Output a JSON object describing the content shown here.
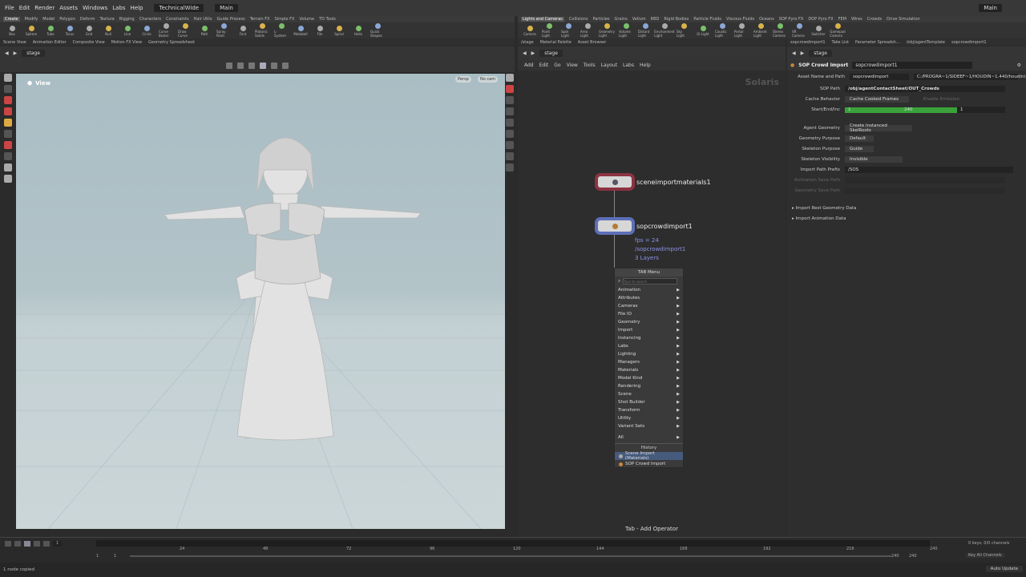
{
  "menubar": {
    "items": [
      "File",
      "Edit",
      "Render",
      "Assets",
      "Windows",
      "Labs",
      "Help"
    ],
    "desktop": "TechnicalWide",
    "context": "Main",
    "right_context": "Main"
  },
  "shelf_tabs_left": [
    "Create",
    "Modify",
    "Model",
    "Polygon",
    "Deform",
    "Texture",
    "Rigging",
    "Characters",
    "Constraints",
    "Hair Utils",
    "Guide Process",
    "Terrain FX",
    "Simple FX",
    "Volume",
    "TD Tools"
  ],
  "shelf_tools_left": [
    "Box",
    "Sphere",
    "Tube",
    "Torus",
    "Grid",
    "Null",
    "Line",
    "Circle",
    "Curve Bezier",
    "Draw Curve",
    "Path",
    "Spray Paint",
    "Font",
    "Platonic Solids",
    "L-System",
    "Metaball",
    "File",
    "Spiral",
    "Helix",
    "Quick Shapes"
  ],
  "shelf_tabs_right": [
    "Lights and Cameras",
    "Collisions",
    "Particles",
    "Grains",
    "Vellum",
    "RBD",
    "Rigid Bodies",
    "Particle Fluids",
    "Viscous Fluids",
    "Oceans",
    "SOP Pyro FX",
    "DOP Pyro FX",
    "FEM",
    "Wires",
    "Crowds",
    "Drive Simulation"
  ],
  "shelf_tools_right": [
    "Camera",
    "Point Light",
    "Spot Light",
    "Area Light",
    "Geometry Light",
    "Volume Light",
    "Distant Light",
    "Environment Light",
    "Sky Light",
    "GI Light",
    "Caustic Light",
    "Portal Light",
    "Ambient Light",
    "Stereo Camera",
    "VR Camera",
    "Switcher",
    "Gamepad Camera"
  ],
  "pane_tabs_left": [
    "Scene View",
    "Animation Editor",
    "Composite View",
    "Motion FX View",
    "Geometry Spreadsheet"
  ],
  "pane_tabs_mid": [
    "/stage",
    "Material Palette",
    "Asset Browser"
  ],
  "pane_tabs_right": [
    "sopcrowdimport1",
    "Take List",
    "Parameter Spreadsh...",
    "/obj/agentTemplate",
    "sopcrowdimport1"
  ],
  "viewport": {
    "path": "stage",
    "label": "View",
    "persp": "Persp",
    "cam": "No cam"
  },
  "network": {
    "path": "stage",
    "menu": [
      "Add",
      "Edit",
      "Go",
      "View",
      "Tools",
      "Layout",
      "Labs",
      "Help"
    ],
    "watermark": "Solaris",
    "status": "Tab - Add Operator",
    "node1": {
      "name": "sceneimportmaterials1"
    },
    "node2": {
      "name": "sopcrowdimport1",
      "fps": "fps = 24",
      "path": "/sopcrowdimport1",
      "layers": "3 Layers"
    }
  },
  "tabmenu": {
    "title": "TAB Menu",
    "placeholder": "Type to search",
    "items": [
      "Animation",
      "Attributes",
      "Cameras",
      "File IO",
      "Geometry",
      "Import",
      "Instancing",
      "Labs",
      "Lighting",
      "Managers",
      "Materials",
      "Model Kind",
      "Rendering",
      "Scene",
      "Shot Builder",
      "Transform",
      "Utility",
      "Variant Sets"
    ],
    "all": "All",
    "history_title": "History",
    "history": [
      "Scene Import (Materials)",
      "SOP Crowd Import"
    ]
  },
  "params": {
    "path": "stage",
    "type": "SOP Crowd Import",
    "name": "sopcrowdimport1",
    "asset_label": "Asset Name and Path",
    "asset_value": "sopcrowdimport",
    "asset_path": "C:/PROGRA~1/SIDEEF~1/HOUDIN~1.440/houdini...",
    "sop_path_label": "SOP Path",
    "sop_path": "/obj/agentContactSheet/OUT_Crowds",
    "cache_label": "Cache Behavior",
    "cache_value": "Cache Cooked Frames",
    "enable_emission": "Enable Emission",
    "range_label": "Start/End/Inc",
    "range_start": "1",
    "range_end": "240",
    "range_inc": "1",
    "agent_geo_label": "Agent Geometry",
    "agent_geo": "Create Instanced SkelRoots",
    "geo_purpose_label": "Geometry Purpose",
    "geo_purpose": "Default",
    "skel_purpose_label": "Skeleton Purpose",
    "skel_purpose": "Guide",
    "skel_vis_label": "Skeleton Visibility",
    "skel_vis": "Invisible",
    "import_prefix_label": "Import Path Prefix",
    "import_prefix": "/SOS",
    "anim_save": "Animation Save Path",
    "geo_save": "Geometry Save Path",
    "sect1": "Import Rest Geometry Data",
    "sect2": "Import Animation Data"
  },
  "timeline": {
    "frame": "1",
    "start": "1",
    "start2": "1",
    "end": "240",
    "end2": "240",
    "ticks": [
      "24",
      "48",
      "72",
      "96",
      "120",
      "144",
      "168",
      "192",
      "216",
      "240"
    ],
    "keys": "0 keys, 0/0 channels",
    "keymode": "Key All Channels"
  },
  "status": {
    "text": "1 node copied",
    "auto": "Auto Update"
  }
}
